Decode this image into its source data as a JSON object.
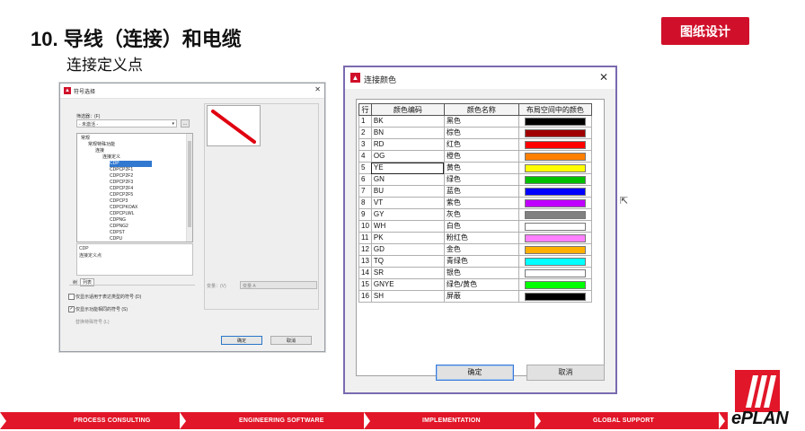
{
  "slide": {
    "title": "10. 导线（连接）和电缆",
    "subtitle": "连接定义点",
    "badge": "图纸设计"
  },
  "symbol_dialog": {
    "title": "符号选择",
    "filter_label": "筛选器：(F)",
    "filter_value": "- 未激活 -",
    "browse_button": "...",
    "tree": [
      {
        "label": "常规",
        "level": 0
      },
      {
        "label": "常规特殊功能",
        "level": 1
      },
      {
        "label": "连接",
        "level": 2
      },
      {
        "label": "连接定义",
        "level": 3
      },
      {
        "label": "CDP",
        "level": 4,
        "selected": true
      },
      {
        "label": "CDPCP2F1",
        "level": 4
      },
      {
        "label": "CDPCP2F2",
        "level": 4
      },
      {
        "label": "CDPCP2F3",
        "level": 4
      },
      {
        "label": "CDPCP2F4",
        "level": 4
      },
      {
        "label": "CDPCP2F5",
        "level": 4
      },
      {
        "label": "CDPCP3",
        "level": 4
      },
      {
        "label": "CDPCPKOAX",
        "level": 4
      },
      {
        "label": "CDPCPLWL",
        "level": 4
      },
      {
        "label": "CDPNG",
        "level": 4
      },
      {
        "label": "CDPNG2",
        "level": 4
      },
      {
        "label": "CDPST",
        "level": 4
      },
      {
        "label": "CDPU",
        "level": 4
      }
    ],
    "desc_name": "CDP",
    "desc_text": "连接定义点",
    "tab_tree": "树",
    "tab_list": "列表",
    "check1": "仅显示适用于表达类型的符号 (D)",
    "check2": "仅显示功能相同的符号 (S)",
    "replace_button": "替换特殊符号 (L)",
    "variant_label": "变量：(V)",
    "variant_value": "变量 A",
    "ok": "确定",
    "cancel": "取消"
  },
  "color_dialog": {
    "title": "连接颜色",
    "headers": [
      "行",
      "颜色编码",
      "颜色名称",
      "布局空间中的颜色"
    ],
    "rows": [
      {
        "n": "1",
        "code": "BK",
        "name": "黑色",
        "color": "#000000"
      },
      {
        "n": "2",
        "code": "BN",
        "name": "棕色",
        "color": "#a00000"
      },
      {
        "n": "3",
        "code": "RD",
        "name": "红色",
        "color": "#ff0000"
      },
      {
        "n": "4",
        "code": "OG",
        "name": "橙色",
        "color": "#ff8000"
      },
      {
        "n": "5",
        "code": "YE",
        "name": "黄色",
        "color": "#ffff00"
      },
      {
        "n": "6",
        "code": "GN",
        "name": "绿色",
        "color": "#00c000"
      },
      {
        "n": "7",
        "code": "BU",
        "name": "蓝色",
        "color": "#0000ff"
      },
      {
        "n": "8",
        "code": "VT",
        "name": "紫色",
        "color": "#c000ff"
      },
      {
        "n": "9",
        "code": "GY",
        "name": "灰色",
        "color": "#808080"
      },
      {
        "n": "10",
        "code": "WH",
        "name": "白色",
        "color": "#ffffff"
      },
      {
        "n": "11",
        "code": "PK",
        "name": "粉红色",
        "color": "#ff80ff"
      },
      {
        "n": "12",
        "code": "GD",
        "name": "金色",
        "color": "#ffb000"
      },
      {
        "n": "13",
        "code": "TQ",
        "name": "青绿色",
        "color": "#00ffff"
      },
      {
        "n": "14",
        "code": "SR",
        "name": "银色",
        "color": "#ffffff"
      },
      {
        "n": "15",
        "code": "GNYE",
        "name": "绿色/黄色",
        "color": "#00ff00"
      },
      {
        "n": "16",
        "code": "SH",
        "name": "屏蔽",
        "color": "#000000"
      }
    ],
    "ok": "确定",
    "cancel": "取消"
  },
  "footer": {
    "items": [
      "PROCESS CONSULTING",
      "ENGINEERING SOFTWARE",
      "IMPLEMENTATION",
      "GLOBAL SUPPORT"
    ],
    "logo_text": "ePLAN",
    "accent": "#e11628"
  }
}
